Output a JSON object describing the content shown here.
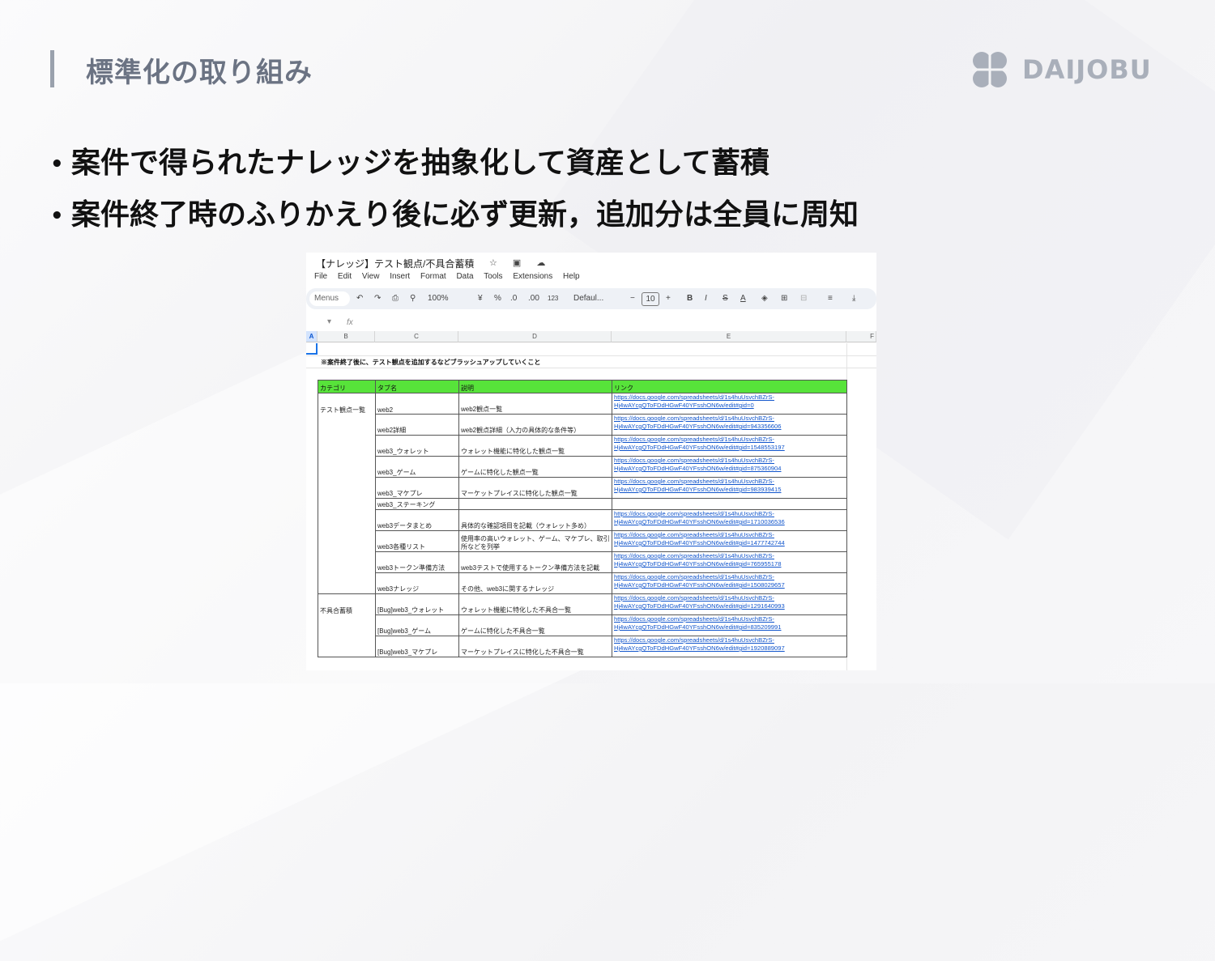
{
  "slide": {
    "title": "標準化の取り組み",
    "logo_text": "DAIJOBU",
    "bullets": [
      "案件で得られたナレッジを抽象化して資産として蓄積",
      "案件終了時のふりかえり後に必ず更新，追加分は全員に周知"
    ],
    "bullet_marker": "•"
  },
  "spreadsheet": {
    "doc_title": "【ナレッジ】テスト観点/不具合蓄積",
    "title_icons": "☆ ▣ ☁",
    "menu": [
      "File",
      "Edit",
      "View",
      "Insert",
      "Format",
      "Data",
      "Tools",
      "Extensions",
      "Help"
    ],
    "toolbar": {
      "menus": "Menus",
      "undo": "↶",
      "redo": "↷",
      "print": "⎙",
      "paint": "⚲",
      "zoom": "100%",
      "currency": "¥",
      "percent": "%",
      "dec_dec": ".0",
      "dec_inc": ".00",
      "num_format": "123",
      "font": "Defaul...",
      "font_minus": "−",
      "font_size": "10",
      "font_plus": "+",
      "bold": "B",
      "italic": "I",
      "strike": "S",
      "text_color": "A",
      "fill": "◈",
      "borders": "⊞",
      "merge": "⊟",
      "align": "≡",
      "valign": "⤓"
    },
    "formula_dropdown": "▾",
    "fx": "fx",
    "columns": [
      "A",
      "B",
      "C",
      "D",
      "E",
      "F"
    ],
    "note": "※案件終了後に、テスト観点を追加するなどブラッシュアップしていくこと",
    "headers": [
      "カテゴリ",
      "タブ名",
      "説明",
      "リンク"
    ],
    "rows": [
      {
        "cat": "テスト観点一覧",
        "tab": "web2",
        "desc": "web2観点一覧",
        "link": "https://docs.google.com/spreadsheets/d/1s4huUsvchBZrS-Hj4wAYcgQToFDdHGwF40YFsshON6w/edit#gid=0"
      },
      {
        "cat": "",
        "tab": "web2詳細",
        "desc": "web2観点詳細（入力の具体的な条件等）",
        "link": "https://docs.google.com/spreadsheets/d/1s4huUsvchBZrS-Hj4wAYcgQToFDdHGwF40YFsshON6w/edit#gid=943356606"
      },
      {
        "cat": "",
        "tab": "web3_ウォレット",
        "desc": "ウォレット機能に特化した観点一覧",
        "link": "https://docs.google.com/spreadsheets/d/1s4huUsvchBZrS-Hj4wAYcgQToFDdHGwF40YFsshON6w/edit#gid=1548553197"
      },
      {
        "cat": "",
        "tab": "web3_ゲーム",
        "desc": "ゲームに特化した観点一覧",
        "link": "https://docs.google.com/spreadsheets/d/1s4huUsvchBZrS-Hj4wAYcgQToFDdHGwF40YFsshON6w/edit#gid=875360904"
      },
      {
        "cat": "",
        "tab": "web3_マケプレ",
        "desc": "マーケットプレイスに特化した観点一覧",
        "link": "https://docs.google.com/spreadsheets/d/1s4huUsvchBZrS-Hj4wAYcgQToFDdHGwF40YFsshON6w/edit#gid=983939415"
      },
      {
        "cat": "",
        "tab": "web3_ステーキング",
        "desc": "",
        "link": ""
      },
      {
        "cat": "",
        "tab": "web3データまとめ",
        "desc": "具体的な確認項目を記載（ウォレット多め）",
        "link": "https://docs.google.com/spreadsheets/d/1s4huUsvchBZrS-Hj4wAYcgQToFDdHGwF40YFsshON6w/edit#gid=1710036536"
      },
      {
        "cat": "",
        "tab": "web3各種リスト",
        "desc": "使用率の高いウォレット、ゲーム、マケプレ、取引所などを列挙",
        "link": "https://docs.google.com/spreadsheets/d/1s4huUsvchBZrS-Hj4wAYcgQToFDdHGwF40YFsshON6w/edit#gid=1477742744"
      },
      {
        "cat": "",
        "tab": "web3トークン準備方法",
        "desc": "web3テストで使用するトークン準備方法を記載",
        "link": "https://docs.google.com/spreadsheets/d/1s4huUsvchBZrS-Hj4wAYcgQToFDdHGwF40YFsshON6w/edit#gid=765955178"
      },
      {
        "cat": "",
        "tab": "web3ナレッジ",
        "desc": "その他、web3に関するナレッジ",
        "link": "https://docs.google.com/spreadsheets/d/1s4huUsvchBZrS-Hj4wAYcgQToFDdHGwF40YFsshON6w/edit#gid=1508029657"
      },
      {
        "cat": "不具合蓄積",
        "tab": "[Bug]web3_ウォレット",
        "desc": "ウォレット機能に特化した不具合一覧",
        "link": "https://docs.google.com/spreadsheets/d/1s4huUsvchBZrS-Hj4wAYcgQToFDdHGwF40YFsshON6w/edit#gid=1291640993"
      },
      {
        "cat": "",
        "tab": "[Bug]web3_ゲーム",
        "desc": "ゲームに特化した不具合一覧",
        "link": "https://docs.google.com/spreadsheets/d/1s4huUsvchBZrS-Hj4wAYcgQToFDdHGwF40YFsshON6w/edit#gid=835209991"
      },
      {
        "cat": "",
        "tab": "[Bug]web3_マケプレ",
        "desc": "マーケットプレイスに特化した不具合一覧",
        "link": "https://docs.google.com/spreadsheets/d/1s4huUsvchBZrS-Hj4wAYcgQToFDdHGwF40YFsshON6w/edit#gid=1920889097"
      }
    ]
  }
}
